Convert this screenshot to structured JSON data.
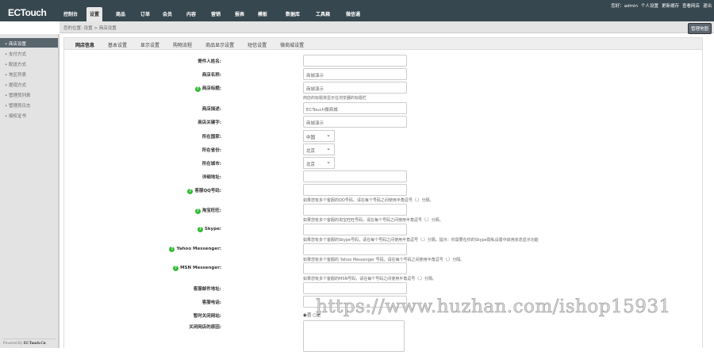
{
  "header": {
    "logo": "ECTouch",
    "nav": [
      "控制台",
      "设置",
      "商品",
      "订单",
      "会员",
      "内容",
      "营销",
      "报表",
      "模板",
      "数据库",
      "工具箱",
      "微信通"
    ],
    "active_nav": 1,
    "user_links": [
      "您好：admin",
      "个人设置",
      "更新缓存",
      "查看网店",
      "退出"
    ]
  },
  "breadcrumb": "您的位置: 设置 > 商店设置",
  "map_button": "管理地图",
  "sidebar": {
    "items": [
      "商店设置",
      "支付方式",
      "配送方式",
      "地区列表",
      "提现方式",
      "管理员列表",
      "管理员日志",
      "授权证书"
    ],
    "active": 0,
    "powered_prefix": "Powered By",
    "powered_brand": "ECTouch.Cn"
  },
  "tabs": [
    "网店信息",
    "基本设置",
    "显示设置",
    "购物流程",
    "商品显示设置",
    "短信设置",
    "微商城设置"
  ],
  "form": [
    {
      "label": "寄件人姓名:",
      "type": "input",
      "value": ""
    },
    {
      "label": "商店名称:",
      "type": "input",
      "value": "商城演示"
    },
    {
      "label": "商店标题:",
      "type": "input",
      "value": "商城演示",
      "help": true,
      "note": "商店的标题将显示在浏览器的标题栏"
    },
    {
      "label": "商店描述:",
      "type": "input",
      "value": "ECTouch微商城"
    },
    {
      "label": "商店关键字:",
      "type": "input",
      "value": "商城演示"
    },
    {
      "label": "所在国家:",
      "type": "select",
      "value": "中国"
    },
    {
      "label": "所在省份:",
      "type": "select",
      "value": "北京"
    },
    {
      "label": "所在城市:",
      "type": "select",
      "value": "北京"
    },
    {
      "label": "详细地址:",
      "type": "input",
      "value": ""
    },
    {
      "label": "客服QQ号码:",
      "type": "input",
      "value": "",
      "help": true,
      "note": "如果您有多个客服的QQ号码，请在每个号码之间使用半角逗号（,）分隔。"
    },
    {
      "label": "淘宝旺旺:",
      "type": "input",
      "value": "",
      "help": true,
      "note": "如果您有多个客服的淘宝旺旺号码，请在每个号码之间使用半角逗号（,）分隔。"
    },
    {
      "label": "Skype:",
      "type": "input",
      "value": "",
      "help": true,
      "note": "如果您有多个客服的Skype号码，请在每个号码之间使用半角逗号（,）分隔。提示：你需要在你的Skype隐私设置中启用状态显示功能"
    },
    {
      "label": "Yahoo Messenger:",
      "type": "input",
      "value": "",
      "help": true,
      "note": "如果您有多个客服的 Yahoo Messenger 号码，请在每个号码之间使用半角逗号（,）分隔。"
    },
    {
      "label": "MSN Messenger:",
      "type": "input",
      "value": "",
      "help": true,
      "note": "如果您有多个客服的MSN号码，请在每个号码之间使用半角逗号（,）分隔。"
    },
    {
      "label": "客服邮件地址:",
      "type": "input",
      "value": ""
    },
    {
      "label": "客服电话:",
      "type": "input",
      "value": ""
    },
    {
      "label": "暂时关闭网站:",
      "type": "radio",
      "options": [
        "否",
        "是"
      ],
      "selected": 0
    },
    {
      "label": "关闭网店的原因:",
      "type": "textarea",
      "value": ""
    }
  ],
  "watermark": "https://www.huzhan.com/ishop15931"
}
